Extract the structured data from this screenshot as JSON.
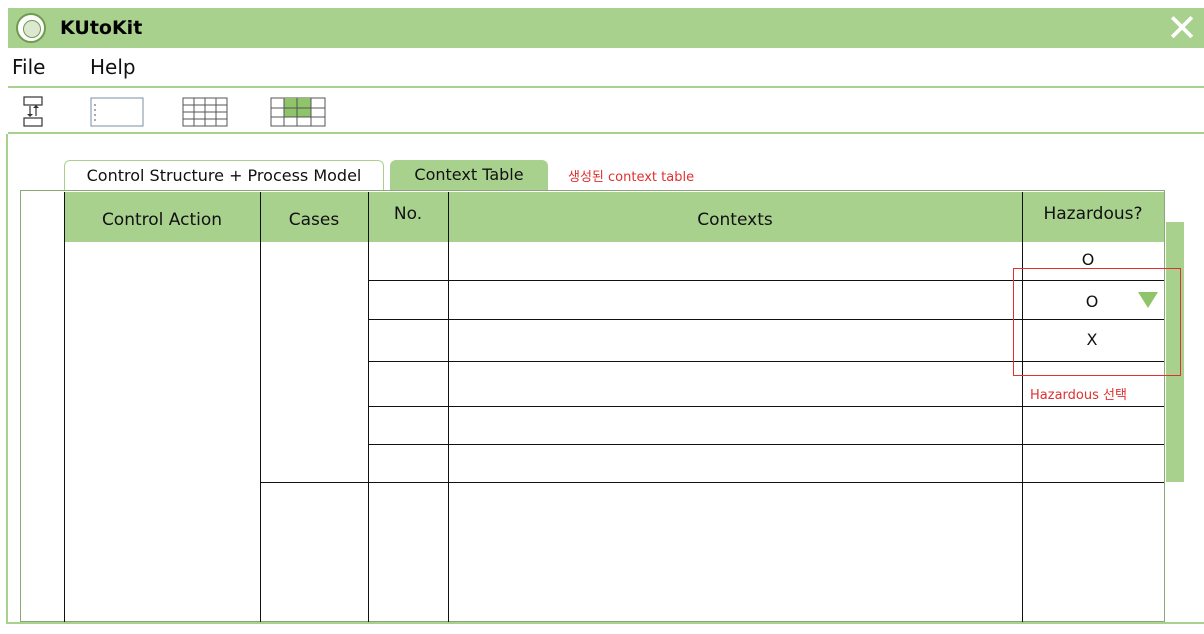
{
  "window": {
    "title": "KUtoKit",
    "logo_icon": "university-seal-icon",
    "close_icon": "close-x-icon",
    "accent": "#a9d18e"
  },
  "menu": {
    "file": "File",
    "help": "Help"
  },
  "toolbar": {
    "tools": [
      "control-structure-tool-icon",
      "list-tool-icon",
      "grid-table-tool-icon",
      "context-table-tool-icon"
    ]
  },
  "tabs": {
    "control_structure": "Control Structure + Process Model",
    "context_table": "Context Table",
    "active": "Context Table"
  },
  "annotations": {
    "tab_note": "생성된 context table",
    "hazard_note": "Hazardous 선택",
    "color": "#e03030"
  },
  "table": {
    "headers": {
      "control_action": "Control Action",
      "cases": "Cases",
      "no": "No.",
      "contexts": "Contexts",
      "hazardous": "Hazardous?"
    },
    "row1_hazardous": "O",
    "dropdown": {
      "selected": "O",
      "options": [
        "O",
        "X"
      ]
    }
  }
}
